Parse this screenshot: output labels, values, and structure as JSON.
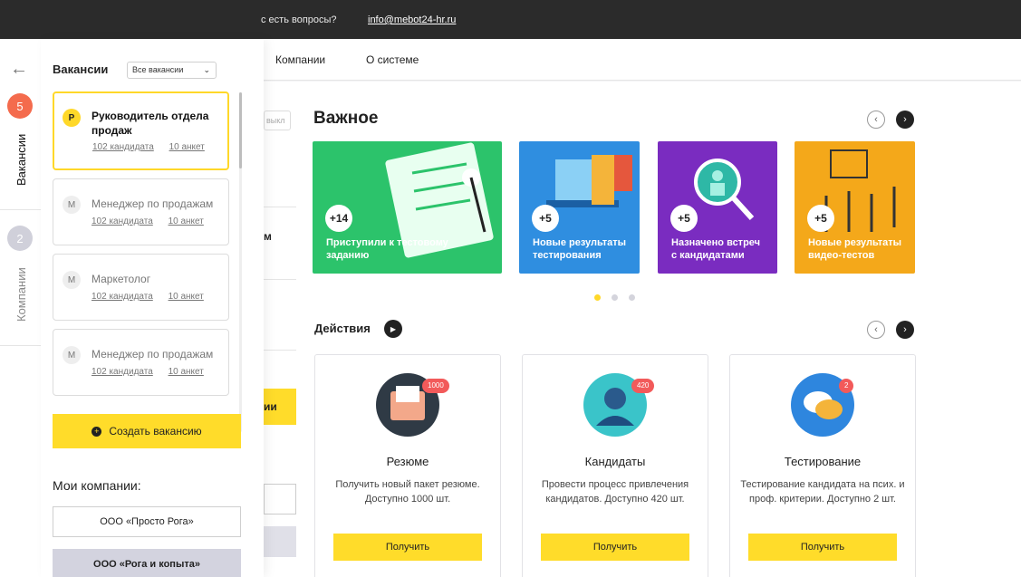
{
  "topbar": {
    "question": "с есть вопросы?",
    "email": "info@mebot24-hr.ru"
  },
  "nav": {
    "companies": "Компании",
    "about": "О системе"
  },
  "important": {
    "title": "Важное",
    "cards": [
      {
        "count": "+14",
        "text": "Приступили к тестовому заданию",
        "color": "#2cc36b"
      },
      {
        "count": "+5",
        "text": "Новые результаты тестирования",
        "color": "#2f8ee0"
      },
      {
        "count": "+5",
        "text": "Назначено встреч с кандидатами",
        "color": "#7a2cc0"
      },
      {
        "count": "+5",
        "text": "Новые результаты видео-тестов",
        "color": "#f4a81a"
      }
    ]
  },
  "actions": {
    "title": "Действия",
    "cards": [
      {
        "title": "Резюме",
        "desc": "Получить новый пакет резюме. Доступно 1000 шт.",
        "count": "1000",
        "button": "Получить"
      },
      {
        "title": "Кандидаты",
        "desc": "Провести процесс привлечения кандидатов. Доступно 420 шт.",
        "count": "420",
        "button": "Получить"
      },
      {
        "title": "Тестирование",
        "desc": "Тестирование кандидата на псих. и проф. критерии. Доступно 2 шт.",
        "count": "2",
        "button": "Получить"
      }
    ]
  },
  "fragments": {
    "off": "выкл",
    "m": "м",
    "ii": "ии"
  },
  "rail": {
    "vacancies_count": "5",
    "vacancies_label": "Вакансии",
    "companies_count": "2",
    "companies_label": "Компании"
  },
  "panel": {
    "title": "Вакансии",
    "filter": "Все вакансии",
    "vacancies": [
      {
        "initial": "Р",
        "name": "Руководитель отдела продаж",
        "candidates": "102 кандидата",
        "forms": "10 анкет"
      },
      {
        "initial": "М",
        "name": "Менеджер по продажам",
        "candidates": "102 кандидата",
        "forms": "10 анкет"
      },
      {
        "initial": "М",
        "name": "Маркетолог",
        "candidates": "102 кандидата",
        "forms": "10 анкет"
      },
      {
        "initial": "М",
        "name": "Менеджер по продажам",
        "candidates": "102 кандидата",
        "forms": "10 анкет"
      }
    ],
    "create_button": "Создать вакансию",
    "my_companies": "Мои компании:",
    "companies": [
      "ООО «Просто Рога»",
      "ООО «Рога и копыта»"
    ]
  },
  "colors": {
    "accent": "#ffdc2a",
    "rail_vacancies": "#f46b4d",
    "rail_companies": "#d0d0da",
    "badge": "#f25a5a"
  }
}
